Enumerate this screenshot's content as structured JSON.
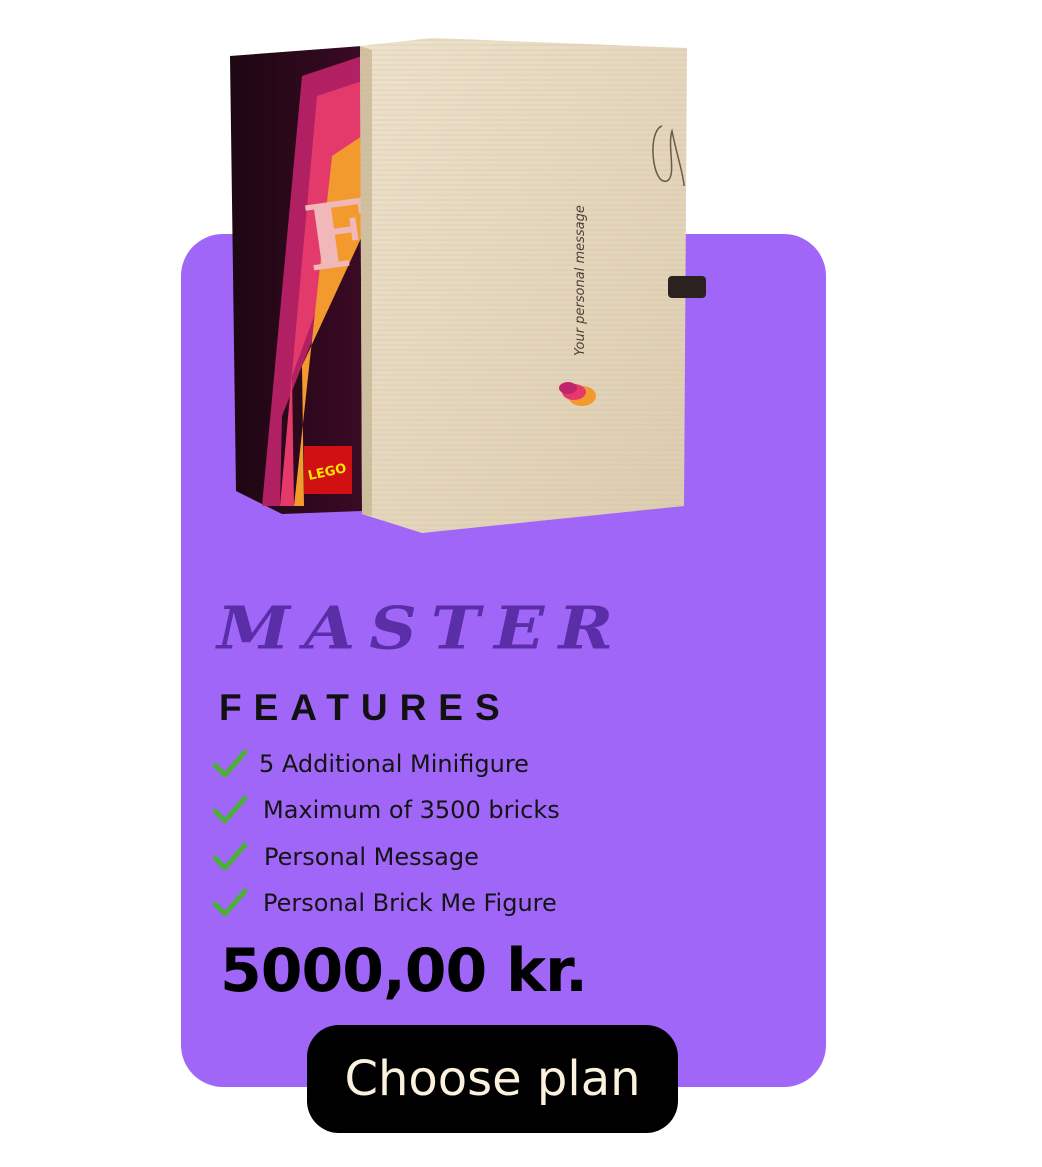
{
  "plan": {
    "name": "MASTER",
    "features_heading": "FEATURES",
    "features": [
      "5 Additional Minifigure",
      "Maximum of 3500 bricks",
      "Personal Message",
      "Personal Brick Me Figure"
    ],
    "price": "5000,00 kr.",
    "cta_label": "Choose plan"
  },
  "product_image": {
    "box_text": "Your personal message",
    "brand_badge": "LEGO"
  },
  "colors": {
    "card": "#a066f8",
    "title": "#5a2ea6",
    "check": "#4caf3a",
    "button": "#000000",
    "button_text": "#fbf1dc"
  },
  "icons": {
    "feature_bullet": "checkmark-icon"
  }
}
